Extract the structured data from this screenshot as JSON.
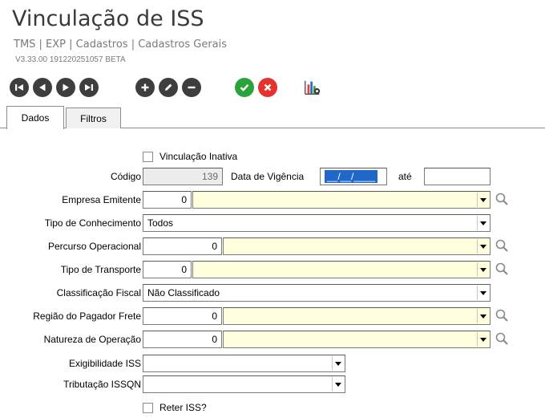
{
  "header": {
    "title": "Vinculação de ISS",
    "breadcrumb": "TMS | EXP | Cadastros | Cadastros Gerais",
    "version": "V3.33.00 191220251057 BETA"
  },
  "toolbar": {
    "buttons": [
      {
        "name": "first-record",
        "icon": "skip-back-icon"
      },
      {
        "name": "previous-record",
        "icon": "play-back-icon"
      },
      {
        "name": "next-record",
        "icon": "play-forward-icon"
      },
      {
        "name": "last-record",
        "icon": "skip-forward-icon"
      },
      {
        "name": "add",
        "icon": "plus-icon"
      },
      {
        "name": "edit",
        "icon": "pencil-icon"
      },
      {
        "name": "remove",
        "icon": "minus-icon"
      },
      {
        "name": "confirm",
        "icon": "check-icon"
      },
      {
        "name": "cancel",
        "icon": "x-icon"
      },
      {
        "name": "report",
        "icon": "chart-gear-icon"
      }
    ],
    "colors": {
      "dark": "#3e3e3e",
      "green": "#2aa43a",
      "red": "#e5322d"
    }
  },
  "tabs": [
    {
      "label": "Dados",
      "active": true
    },
    {
      "label": "Filtros",
      "active": false
    }
  ],
  "form": {
    "vinculacao_inativa": {
      "label": "Vinculação Inativa",
      "checked": false
    },
    "codigo": {
      "label": "Código",
      "value": "139"
    },
    "data_vigencia": {
      "label": "Data de Vigência",
      "value": "__/__/____"
    },
    "ate": {
      "label": "até",
      "value": ""
    },
    "empresa_emitente": {
      "label": "Empresa Emitente",
      "code": "0",
      "value": ""
    },
    "tipo_conhecimento": {
      "label": "Tipo de Conhecimento",
      "value": "Todos"
    },
    "percurso_operacional": {
      "label": "Percurso Operacional",
      "code": "0",
      "value": ""
    },
    "tipo_transporte": {
      "label": "Tipo de Transporte",
      "code": "0",
      "value": ""
    },
    "classificacao_fiscal": {
      "label": "Classificação Fiscal",
      "value": "Não Classificado"
    },
    "regiao_pagador": {
      "label": "Região do Pagador Frete",
      "code": "0",
      "value": ""
    },
    "natureza_operacao": {
      "label": "Natureza de Operação",
      "code": "0",
      "value": ""
    },
    "exigibilidade_iss": {
      "label": "Exigibilidade ISS",
      "value": ""
    },
    "tributacao_issqn": {
      "label": "Tributação ISSQN",
      "value": ""
    },
    "reter_iss": {
      "label": "Reter ISS?",
      "checked": false
    }
  }
}
